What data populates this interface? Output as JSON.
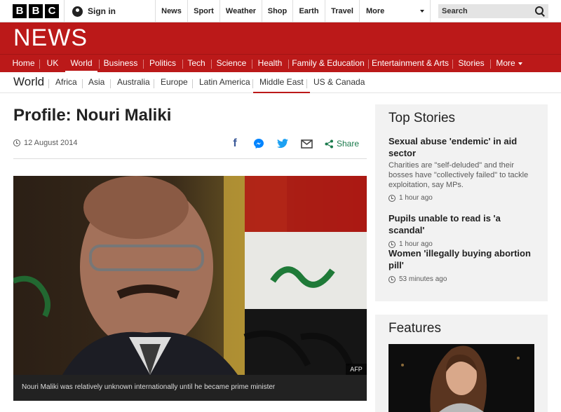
{
  "topbar": {
    "logo_letters": [
      "B",
      "B",
      "C"
    ],
    "signin_label": "Sign in",
    "nav": [
      "News",
      "Sport",
      "Weather",
      "Shop",
      "Earth",
      "Travel"
    ],
    "more_label": "More",
    "search_placeholder": "Search"
  },
  "banner": {
    "logo_text": "NEWS",
    "nav": [
      "Home",
      "UK",
      "World",
      "Business",
      "Politics",
      "Tech",
      "Science",
      "Health",
      "Family & Education",
      "Entertainment & Arts",
      "Stories",
      "More"
    ],
    "active": "World"
  },
  "subnav": {
    "section": "World",
    "items": [
      "Africa",
      "Asia",
      "Australia",
      "Europe",
      "Latin America",
      "Middle East",
      "US & Canada"
    ],
    "active": "Middle East"
  },
  "article": {
    "headline": "Profile: Nouri Maliki",
    "date": "12 August 2014",
    "share_label": "Share",
    "image_credit": "AFP",
    "caption": "Nouri Maliki was relatively unknown internationally until he became prime minister"
  },
  "top_stories": {
    "heading": "Top Stories",
    "items": [
      {
        "title": "Sexual abuse 'endemic' in aid sector",
        "summary": "Charities are \"self-deluded\" and their bosses have \"collectively failed\" to tackle exploitation, say MPs.",
        "time": "1 hour ago"
      },
      {
        "title": "Pupils unable to read is 'a scandal'",
        "summary": "",
        "time": "1 hour ago"
      },
      {
        "title": "Women 'illegally buying abortion pill'",
        "summary": "",
        "time": "53 minutes ago"
      }
    ]
  },
  "features": {
    "heading": "Features"
  },
  "colors": {
    "brand_red": "#bb1919",
    "share_green": "#1a7a4c",
    "facebook_blue": "#3b5998",
    "twitter_blue": "#1da1f2"
  }
}
